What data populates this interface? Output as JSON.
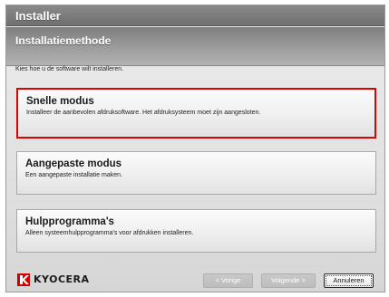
{
  "window": {
    "title": "Installer"
  },
  "header": {
    "title": "Installatiemethode"
  },
  "instruction": "Kies hoe u de software wilt installeren.",
  "options": [
    {
      "title": "Snelle modus",
      "description": "Installeer de aanbevolen afdruksoftware. Het afdruksysteem moet zijn aangesloten.",
      "selected": true
    },
    {
      "title": "Aangepaste modus",
      "description": "Een aangepaste installatie maken.",
      "selected": false
    },
    {
      "title": "Hulpprogramma's",
      "description": "Alleen systeemhulpprogramma's voor afdrukken installeren.",
      "selected": false
    }
  ],
  "footer": {
    "logo_text": "KYOCERA",
    "back_label": "< Vorige",
    "next_label": "Volgende >",
    "cancel_label": "Annuleren"
  },
  "colors": {
    "selected_border": "#e00000",
    "logo_red": "#d40000"
  }
}
